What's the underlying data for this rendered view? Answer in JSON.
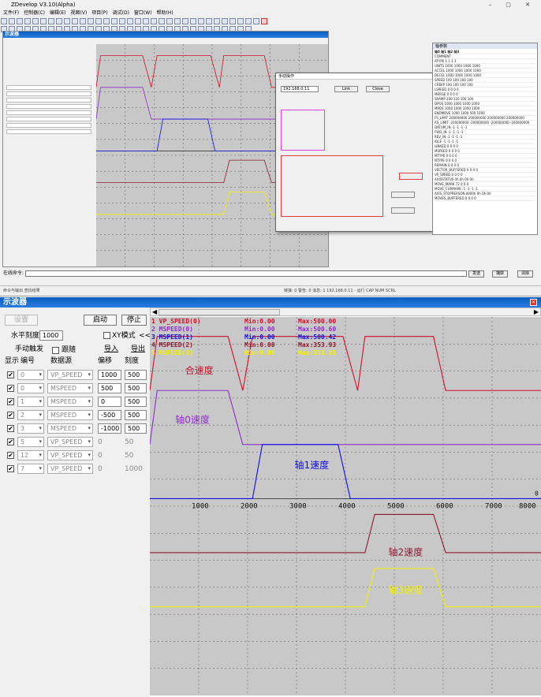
{
  "app": {
    "title": "ZDevelop V3.10(Alpha)",
    "menus": [
      "文件(F)",
      "控制器(C)",
      "编辑(E)",
      "视图(V)",
      "项目(P)",
      "调试(D)",
      "窗口(W)",
      "帮助(H)"
    ],
    "window_controls": "– ▢ ✕"
  },
  "mini": {
    "scope_title": "示波器",
    "dlg_title": "手动操作",
    "ip": "192.168.0.11",
    "link_btn": "Link",
    "close_btn": "Close",
    "param_title": "轴参数",
    "param_tabs": [
      "轴参数",
      "参数选择"
    ],
    "param_cols": [
      "",
      "轴0",
      "轴1",
      "轴2",
      "轴3"
    ],
    "param_rows": [
      [
        "COMMENT",
        "",
        "",
        "",
        ""
      ],
      [
        "ATYPE",
        "1",
        "1",
        "1",
        "1"
      ],
      [
        "UNITS",
        "1000",
        "1000",
        "1000",
        "1000"
      ],
      [
        "ACCEL",
        "1000",
        "1000",
        "1000",
        "1000"
      ],
      [
        "DECEL",
        "1000",
        "1000",
        "1000",
        "1000"
      ],
      [
        "SPEED",
        "100",
        "100",
        "100",
        "100"
      ],
      [
        "CREEP",
        "100",
        "100",
        "100",
        "100"
      ],
      [
        "LSPEED",
        "0",
        "0",
        "0",
        "0"
      ],
      [
        "MERGE",
        "0",
        "0",
        "0",
        "0"
      ],
      [
        "SRAMP",
        "200",
        "120",
        "100",
        "100"
      ],
      [
        "DPOS",
        "1000",
        "1000",
        "1000",
        "1000"
      ],
      [
        "MPOS",
        "1000",
        "1000",
        "1000",
        "1000"
      ],
      [
        "ENDMOVE",
        "1000",
        "1000",
        "500",
        "1000"
      ],
      [
        "FS_LIMIT",
        "200000000",
        "200000000",
        "200000000",
        "200000000"
      ],
      [
        "RS_LIMIT",
        "-200000000",
        "-200000000",
        "-200000000",
        "-200000000"
      ],
      [
        "DATUM_IN",
        "-1",
        "-1",
        "-1",
        "-1"
      ],
      [
        "FWD_IN",
        "-1",
        "-1",
        "-1",
        "-1"
      ],
      [
        "REV_IN",
        "-1",
        "-1",
        "-1",
        "-1"
      ],
      [
        "IDLE",
        "-1",
        "-1",
        "-1",
        "-1"
      ],
      [
        "LINKED",
        "0",
        "0",
        "0",
        "0"
      ],
      [
        "MSPEED",
        "0",
        "0",
        "0",
        "0"
      ],
      [
        "MTYPE",
        "0",
        "0",
        "0",
        "0"
      ],
      [
        "NTYPE",
        "0",
        "0",
        "0",
        "0"
      ],
      [
        "REMAIN",
        "0",
        "0",
        "0",
        "0"
      ],
      [
        "VECTOR_BUFFERED",
        "0",
        "0",
        "0",
        "0"
      ],
      [
        "VP_SPEED",
        "0",
        "0",
        "0",
        "0"
      ],
      [
        "AXISSTATUS",
        "0h",
        "0h",
        "0h",
        "0h"
      ],
      [
        "MOVE_MARK",
        "72",
        "0",
        "0",
        "0"
      ],
      [
        "MOVE_CURMARK",
        "-1",
        "-1",
        "-1",
        "-1"
      ],
      [
        "AXIS_STOPREASON",
        "0000h",
        "0h",
        "0h",
        "0h"
      ],
      [
        "MOVES_BUFFERED",
        "0",
        "0",
        "0",
        "0"
      ]
    ],
    "cmd_label": "在线命令:",
    "send_btn": "发送",
    "capture_btn": "捕获",
    "clear_btn": "清除",
    "status_text": "命令与输出  查找结果",
    "status_right": "链接: 0  警告: 0  消息: 1      192.168.0.11 - 运行                  CAP NUM SCRL"
  },
  "scope": {
    "title": "示波器",
    "btn_setup": "设置",
    "btn_start": "启动",
    "btn_stop": "停止",
    "hscale_label": "水平刻度:",
    "hscale_value": "1000",
    "xy_mode": "XY模式",
    "collapse_btn": "<<",
    "manual_trigger": "手动触发",
    "follow": "跟随",
    "import_btn": "导入",
    "export_btn": "导出",
    "col_show": "显示",
    "col_num": "编号",
    "col_source": "数据源",
    "col_offset": "偏移",
    "col_scale": "刻度",
    "channels": [
      {
        "checked": true,
        "num": "0",
        "source": "VP_SPEED",
        "offset": "1000",
        "scale": "500",
        "active": true
      },
      {
        "checked": true,
        "num": "0",
        "source": "MSPEED",
        "offset": "500",
        "scale": "500",
        "active": true
      },
      {
        "checked": true,
        "num": "1",
        "source": "MSPEED",
        "offset": "0",
        "scale": "500",
        "active": true
      },
      {
        "checked": true,
        "num": "2",
        "source": "MSPEED",
        "offset": "-500",
        "scale": "500",
        "active": true
      },
      {
        "checked": true,
        "num": "3",
        "source": "MSPEED",
        "offset": "-1000",
        "scale": "500",
        "active": true
      },
      {
        "checked": true,
        "num": "5",
        "source": "VP_SPEED",
        "offset": "0",
        "scale": "50",
        "active": false
      },
      {
        "checked": true,
        "num": "12",
        "source": "VP_SPEED",
        "offset": "0",
        "scale": "50",
        "active": false
      },
      {
        "checked": true,
        "num": "7",
        "source": "VP_SPEED",
        "offset": "0",
        "scale": "1000",
        "active": false
      }
    ],
    "legend": [
      {
        "name": "1 VP_SPEED(0)",
        "min": "Min:0.00",
        "max": "Max:500.00",
        "color": "#d0102a"
      },
      {
        "name": "2 MSPEED(0)",
        "min": "Min:0.00",
        "max": "Max:500.60",
        "color": "#8e2ec9"
      },
      {
        "name": "3 MSPEED(1)",
        "min": "Min:0.00",
        "max": "Max:500.42",
        "color": "#1010e0"
      },
      {
        "name": "4 MSPEED(2)",
        "min": "Min:0.00",
        "max": "Max:353.93",
        "color": "#8a1a30"
      },
      {
        "name": "5 MSPEED(3)",
        "min": "Min:0.00",
        "max": "Max:353.93",
        "color": "#f0f000"
      }
    ],
    "trace_labels": [
      "合速度",
      "轴0速度",
      "轴1速度",
      "轴2速度",
      "轴3速度"
    ],
    "x_ticks": [
      "1000",
      "2000",
      "3000",
      "4000",
      "5000",
      "6000",
      "7000",
      "8000"
    ],
    "right_marker": "0"
  },
  "chart_data": {
    "type": "line",
    "x_unit_ticks": [
      1000,
      2000,
      3000,
      4000,
      5000,
      6000,
      7000,
      8000
    ],
    "series": [
      {
        "name": "1 VP_SPEED(0)",
        "min": 0.0,
        "max": 500.0,
        "points": [
          [
            0,
            0
          ],
          [
            150,
            500
          ],
          [
            1600,
            500
          ],
          [
            1900,
            0
          ],
          [
            2100,
            500
          ],
          [
            3950,
            500
          ],
          [
            4250,
            0
          ],
          [
            4400,
            500
          ],
          [
            5800,
            500
          ],
          [
            6050,
            0
          ],
          [
            8000,
            0
          ]
        ]
      },
      {
        "name": "2 MSPEED(0)",
        "min": 0.0,
        "max": 500.6,
        "points": [
          [
            0,
            0
          ],
          [
            150,
            500
          ],
          [
            1600,
            500
          ],
          [
            1900,
            0
          ],
          [
            8000,
            0
          ]
        ]
      },
      {
        "name": "3 MSPEED(1)",
        "min": 0.0,
        "max": 500.42,
        "points": [
          [
            0,
            0
          ],
          [
            2100,
            0
          ],
          [
            2300,
            500
          ],
          [
            3850,
            500
          ],
          [
            4100,
            0
          ],
          [
            8000,
            0
          ]
        ]
      },
      {
        "name": "4 MSPEED(2)",
        "min": 0.0,
        "max": 353.93,
        "points": [
          [
            0,
            0
          ],
          [
            4400,
            0
          ],
          [
            4600,
            354
          ],
          [
            5800,
            354
          ],
          [
            6050,
            0
          ],
          [
            8000,
            0
          ]
        ]
      },
      {
        "name": "5 MSPEED(3)",
        "min": 0.0,
        "max": 353.93,
        "points": [
          [
            0,
            0
          ],
          [
            4400,
            0
          ],
          [
            4600,
            354
          ],
          [
            5800,
            354
          ],
          [
            6050,
            0
          ],
          [
            8000,
            0
          ]
        ]
      }
    ]
  }
}
